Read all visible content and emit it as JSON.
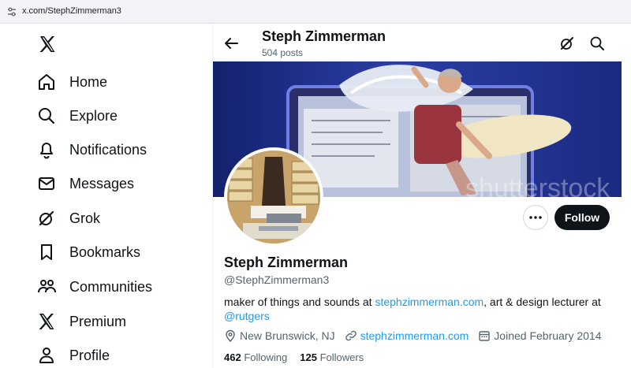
{
  "browser": {
    "url": "x.com/StephZimmerman3"
  },
  "sidebar": {
    "logo_icon": "x-logo-icon",
    "items": [
      {
        "label": "Home",
        "icon": "home-icon"
      },
      {
        "label": "Explore",
        "icon": "search-icon"
      },
      {
        "label": "Notifications",
        "icon": "bell-icon"
      },
      {
        "label": "Messages",
        "icon": "envelope-icon"
      },
      {
        "label": "Grok",
        "icon": "grok-icon"
      },
      {
        "label": "Bookmarks",
        "icon": "bookmark-icon"
      },
      {
        "label": "Communities",
        "icon": "communities-icon"
      },
      {
        "label": "Premium",
        "icon": "x-logo-icon"
      },
      {
        "label": "Profile",
        "icon": "person-icon"
      }
    ]
  },
  "header": {
    "name": "Steph Zimmerman",
    "posts": "504 posts"
  },
  "profile": {
    "name": "Steph Zimmerman",
    "handle": "@StephZimmerman3",
    "bio_prefix": "maker of things and sounds at ",
    "bio_link": "stephzimmerman.com",
    "bio_middle": ", art & design lecturer at",
    "bio_mention": "@rutgers",
    "location": "New Brunswick, NJ",
    "website": "stephzimmerman.com",
    "joined": "Joined February 2014",
    "following_count": "462",
    "following_label": "Following",
    "followers_count": "125",
    "followers_label": "Followers"
  },
  "actions": {
    "follow_label": "Follow"
  },
  "colors": {
    "link": "#1d9bf0",
    "text": "#0f1419",
    "muted": "#536471",
    "follow_bg": "#0f1419"
  }
}
